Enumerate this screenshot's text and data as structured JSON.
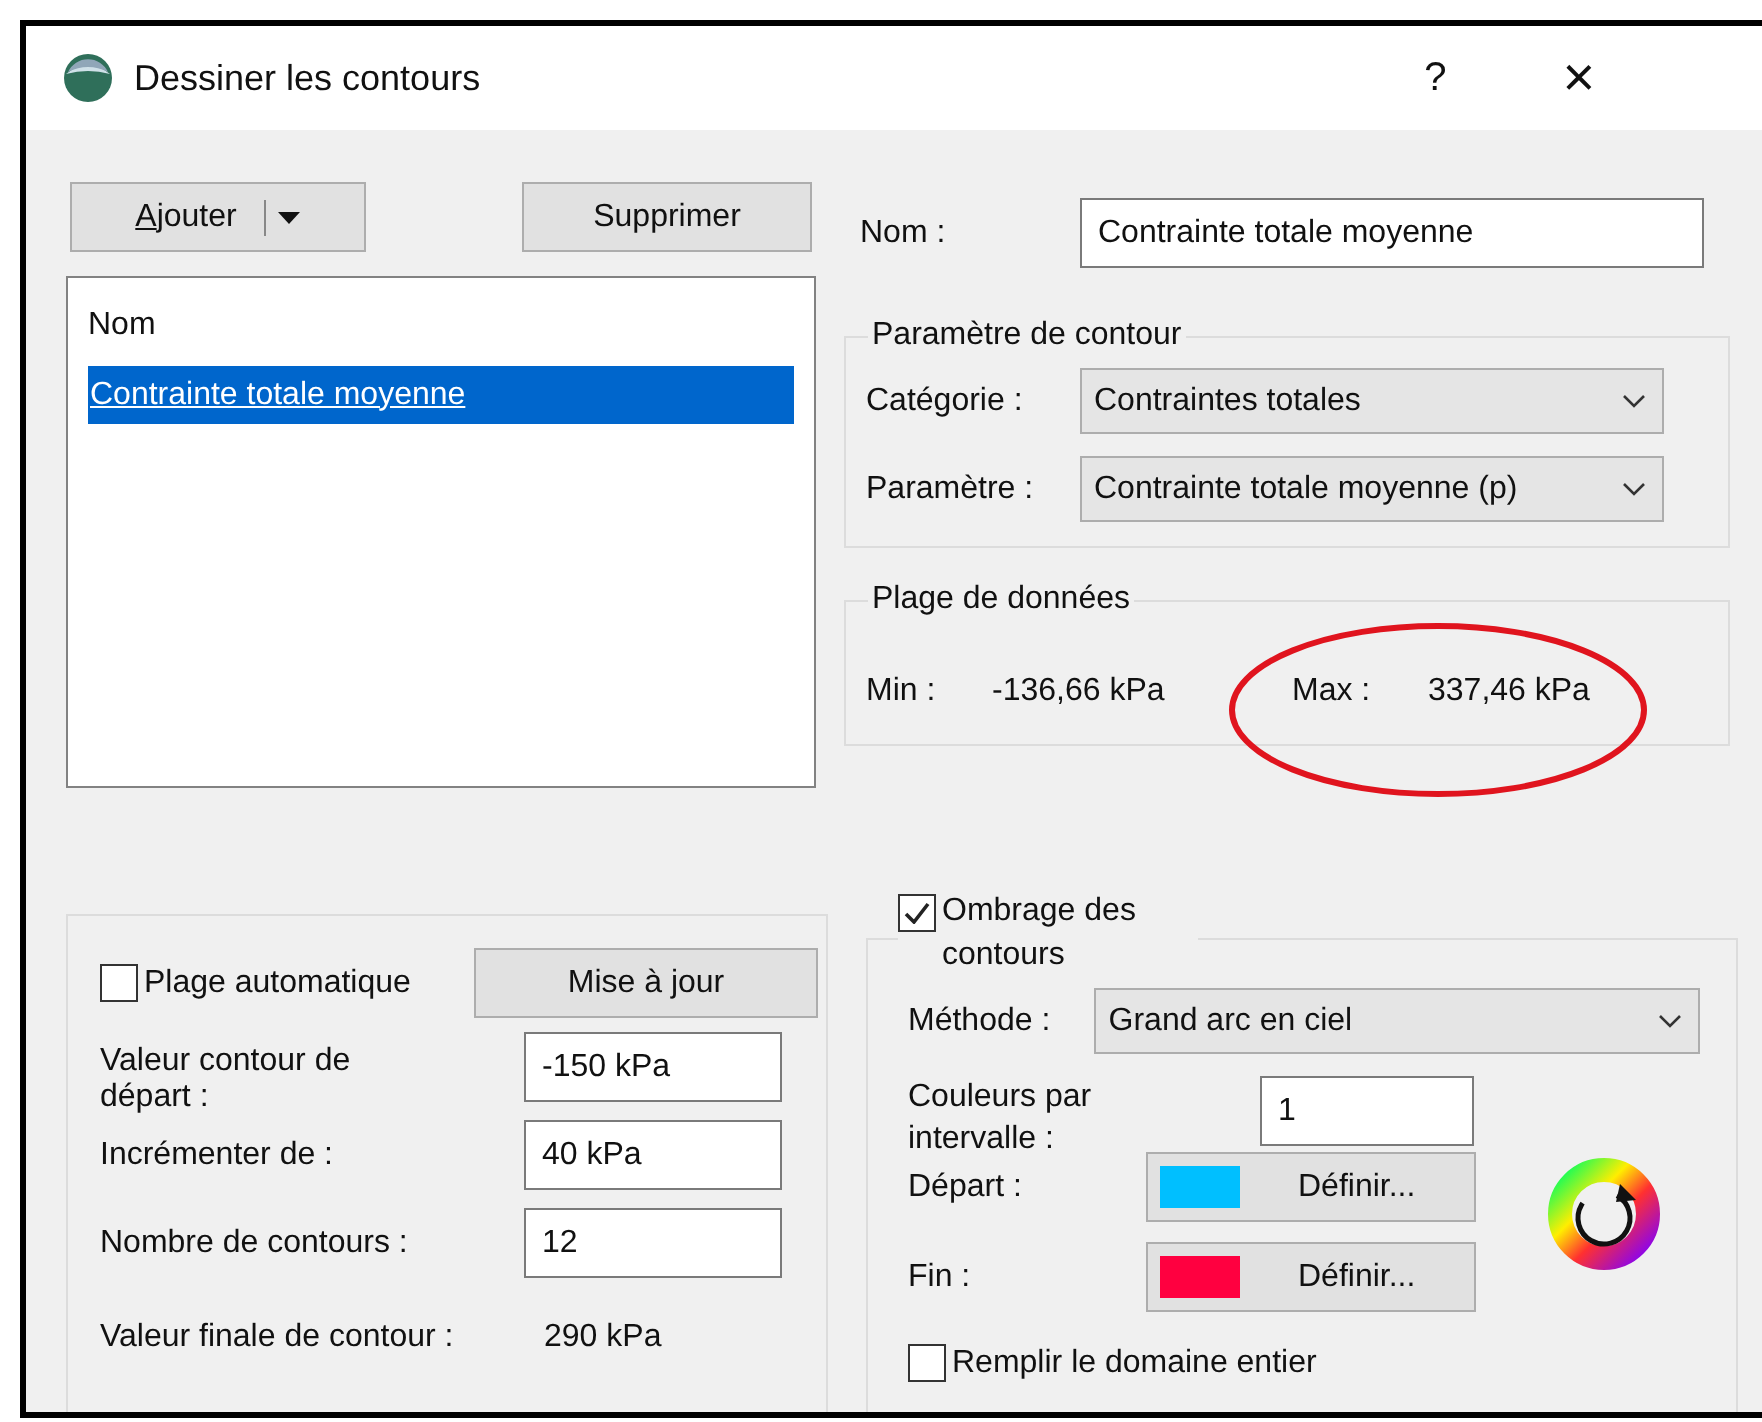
{
  "window": {
    "title": "Dessiner les contours",
    "help": "?",
    "close": "×"
  },
  "toolbar": {
    "add_button": {
      "label": "Ajouter"
    },
    "delete_button": {
      "label": "Supprimer"
    }
  },
  "contour_list": {
    "header": "Nom",
    "items": [
      {
        "label": "Contrainte totale moyenne",
        "selected": true
      }
    ]
  },
  "name_field": {
    "label": "Nom :",
    "value": "Contrainte totale moyenne"
  },
  "contour_parameter": {
    "title": "Paramètre de contour",
    "fields": [
      {
        "label": "Catégorie :",
        "value": "Contraintes totales"
      },
      {
        "label": "Paramètre :",
        "value": "Contrainte totale moyenne (p)"
      }
    ]
  },
  "data_range": {
    "title": "Plage de données",
    "min_label": "Min :",
    "min_value": "-136,66 kPa",
    "max_label": "Max :",
    "max_value": "337,46 kPa",
    "annotation": {
      "kind": "ellipse"
    }
  },
  "range": {
    "auto_range": {
      "label": "Plage automatique",
      "checked": false
    },
    "update_button": "Mise à jour",
    "fields": [
      {
        "label": "Valeur contour de départ :",
        "value": "-150 kPa"
      },
      {
        "label": "Incrémenter de :",
        "value": "40 kPa"
      },
      {
        "label": "Nombre de contours :",
        "value": "12"
      }
    ],
    "final_label": "Valeur finale de contour :",
    "final_value": "290 kPa"
  },
  "shading": {
    "enabled": {
      "label": "Ombrage des contours",
      "checked": true
    },
    "method_label": "Méthode :",
    "method_value": "Grand arc en ciel",
    "colors_label": "Couleurs par intervalle :",
    "colors_value": "1",
    "endpoints": [
      {
        "label": "Départ :",
        "color": "#00bfff",
        "button": "Définir..."
      },
      {
        "label": "Fin :",
        "color": "#ff0040",
        "button": "Définir..."
      }
    ],
    "fill_domain": {
      "label": "Remplir le domaine entier",
      "checked": false
    }
  }
}
